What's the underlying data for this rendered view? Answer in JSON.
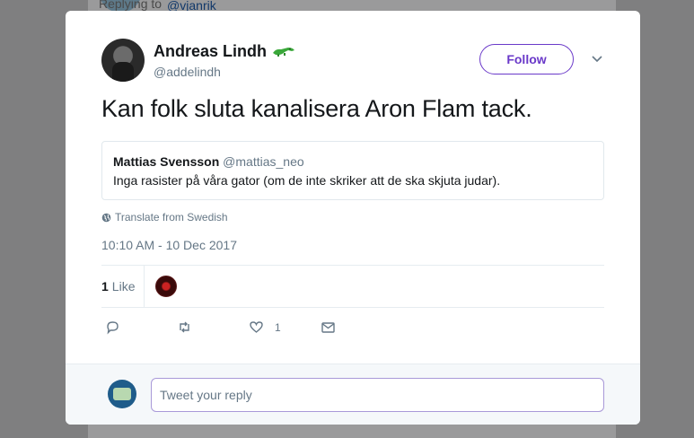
{
  "background": {
    "reply_prefix": "Replying to",
    "reply_handle": "@vjanrik"
  },
  "tweet": {
    "author_name": "Andreas Lindh",
    "author_handle": "@addelindh",
    "follow_label": "Follow",
    "text": "Kan folk sluta kanalisera Aron Flam tack.",
    "quote": {
      "name": "Mattias Svensson",
      "handle": "@mattias_neo",
      "text": "Inga rasister på våra gator (om de inte skriker att de ska skjuta judar)."
    },
    "translate_label": "Translate from Swedish",
    "timestamp": "10:10 AM - 10 Dec 2017",
    "likes_count": "1",
    "likes_label": "Like",
    "actions": {
      "reply_icon": "reply-icon",
      "retweet_icon": "retweet-icon",
      "like_icon": "heart-icon",
      "like_count": "1",
      "dm_icon": "envelope-icon"
    }
  },
  "reply": {
    "placeholder": "Tweet your reply"
  },
  "colors": {
    "accent": "#6a39c9",
    "muted": "#657786",
    "overlay": "#7f7f80",
    "croc": "#3aa83a"
  }
}
